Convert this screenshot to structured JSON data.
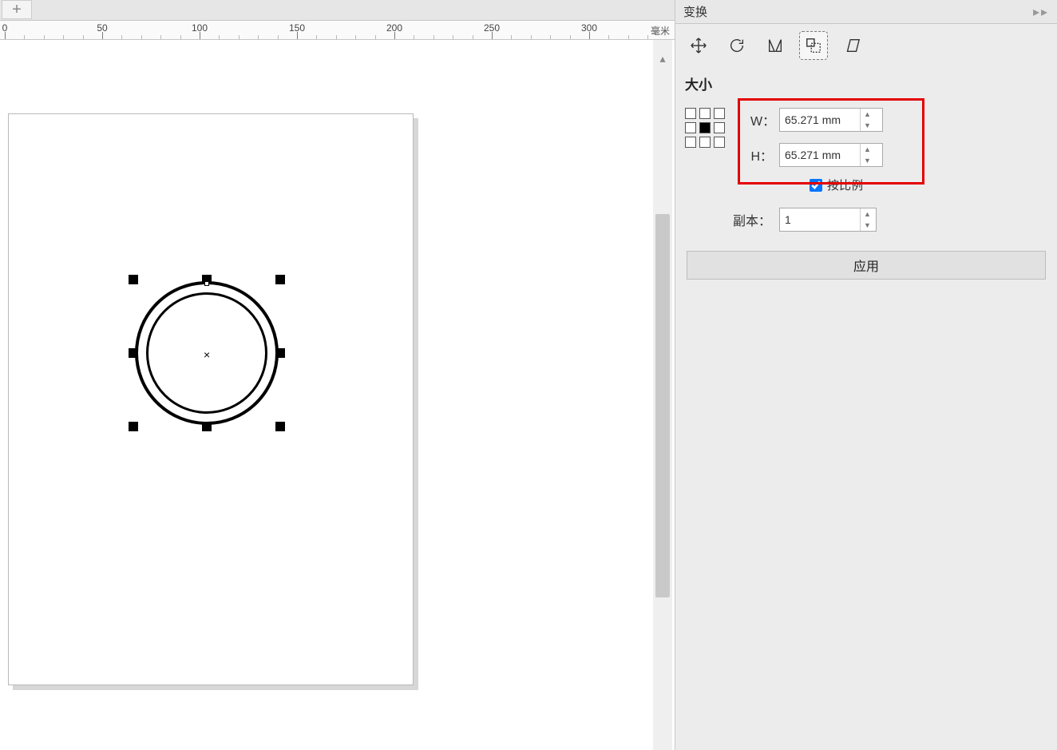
{
  "tab": {
    "plus_label": "+"
  },
  "ruler": {
    "ticks": [
      0,
      50,
      100,
      150,
      200,
      250,
      300
    ],
    "unit_label": "毫米"
  },
  "scrollbar": {
    "up_glyph": "▴"
  },
  "canvas": {
    "object_center_glyph": "×"
  },
  "panel": {
    "title": "变换",
    "menu_glyph": "▸▸",
    "tabs": {
      "position_name": "position",
      "rotate_name": "rotate",
      "skew_name": "skew",
      "size_name": "size",
      "shear_name": "shear"
    },
    "size": {
      "title": "大小",
      "w_label": "W：",
      "h_label": "H：",
      "w_value": "65.271 mm",
      "h_value": "65.271 mm",
      "proportional_label": "按比例",
      "proportional_checked": true
    },
    "copies": {
      "label": "副本：",
      "value": "1"
    },
    "apply_label": "应用"
  }
}
